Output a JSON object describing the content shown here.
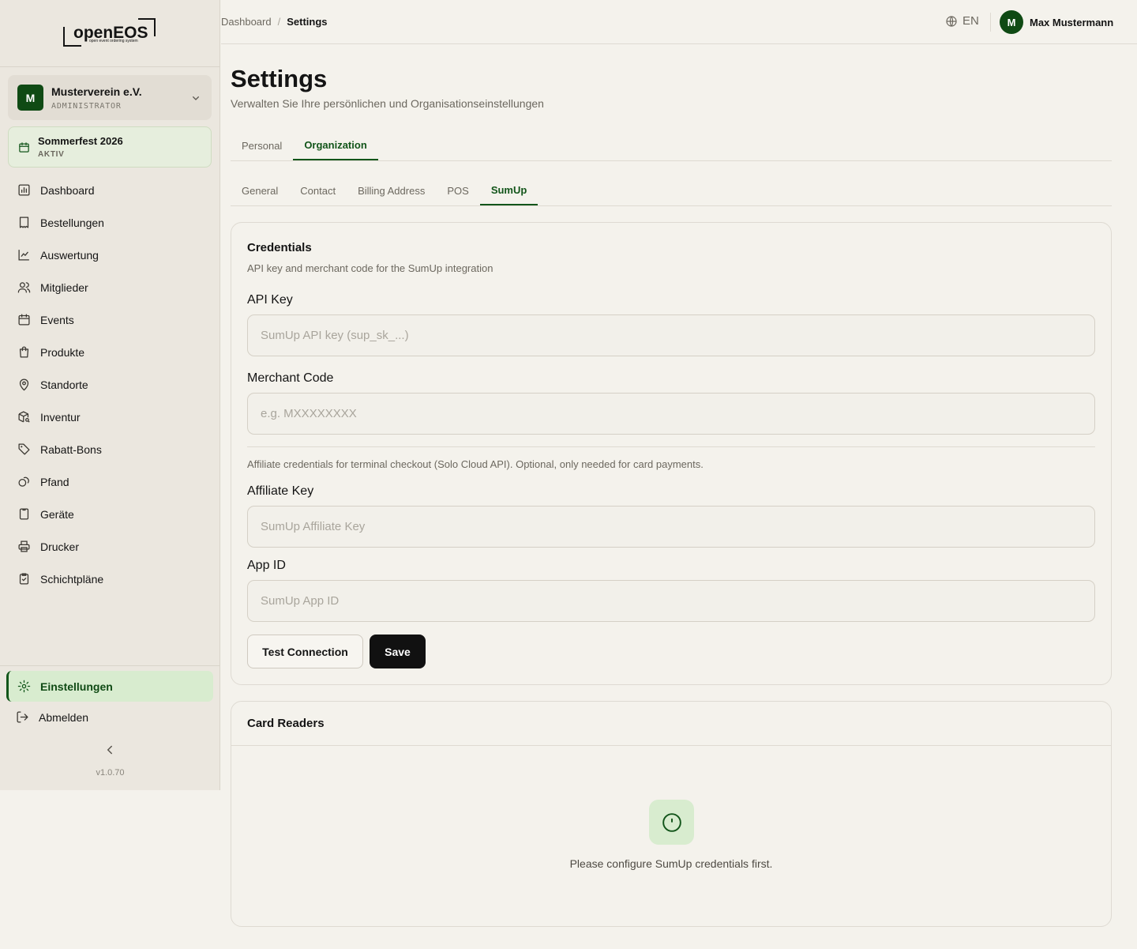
{
  "app": {
    "logo_text": "openEOS",
    "logo_tagline": "open event ordering system",
    "version": "v1.0.70"
  },
  "org": {
    "avatar": "M",
    "name": "Musterverein e.V.",
    "role": "ADMINISTRATOR"
  },
  "event": {
    "name": "Sommerfest 2026",
    "status": "AKTIV"
  },
  "sidebar": {
    "items": [
      {
        "label": "Dashboard",
        "icon": "chart-bar-icon"
      },
      {
        "label": "Bestellungen",
        "icon": "receipt-icon"
      },
      {
        "label": "Auswertung",
        "icon": "line-chart-icon"
      },
      {
        "label": "Mitglieder",
        "icon": "users-icon"
      },
      {
        "label": "Events",
        "icon": "calendar-icon"
      },
      {
        "label": "Produkte",
        "icon": "shopping-bag-icon"
      },
      {
        "label": "Standorte",
        "icon": "map-pin-icon"
      },
      {
        "label": "Inventur",
        "icon": "package-search-icon"
      },
      {
        "label": "Rabatt-Bons",
        "icon": "tag-icon"
      },
      {
        "label": "Pfand",
        "icon": "coins-icon"
      },
      {
        "label": "Geräte",
        "icon": "tablet-icon"
      },
      {
        "label": "Drucker",
        "icon": "printer-icon"
      },
      {
        "label": "Schichtpläne",
        "icon": "clipboard-check-icon"
      }
    ],
    "settings_label": "Einstellungen",
    "logout_label": "Abmelden"
  },
  "topbar": {
    "breadcrumb_root": "Dashboard",
    "breadcrumb_sep": "/",
    "breadcrumb_current": "Settings",
    "language": "EN",
    "user_avatar": "M",
    "user_name": "Max Mustermann"
  },
  "page": {
    "title": "Settings",
    "subtitle": "Verwalten Sie Ihre persönlichen und Organisationseinstellungen"
  },
  "tabs_main": [
    {
      "label": "Personal",
      "active": false
    },
    {
      "label": "Organization",
      "active": true
    }
  ],
  "tabs_sub": [
    {
      "label": "General",
      "active": false
    },
    {
      "label": "Contact",
      "active": false
    },
    {
      "label": "Billing Address",
      "active": false
    },
    {
      "label": "POS",
      "active": false
    },
    {
      "label": "SumUp",
      "active": true
    }
  ],
  "credentials": {
    "title": "Credentials",
    "description": "API key and merchant code for the SumUp integration",
    "api_key_label": "API Key",
    "api_key_placeholder": "SumUp API key (sup_sk_...)",
    "api_key_value": "",
    "merchant_label": "Merchant Code",
    "merchant_placeholder": "e.g. MXXXXXXXX",
    "merchant_value": "",
    "affiliate_note": "Affiliate credentials for terminal checkout (Solo Cloud API). Optional, only needed for card payments.",
    "affiliate_label": "Affiliate Key",
    "affiliate_placeholder": "SumUp Affiliate Key",
    "affiliate_value": "",
    "app_id_label": "App ID",
    "app_id_placeholder": "SumUp App ID",
    "app_id_value": "",
    "test_button": "Test Connection",
    "save_button": "Save"
  },
  "card_readers": {
    "title": "Card Readers",
    "empty_text": "Please configure SumUp credentials first."
  },
  "colors": {
    "accent": "#0f4a14",
    "active_bg": "#d8eccf",
    "sidebar_bg": "#ebe7df",
    "page_bg": "#f4f2ec"
  }
}
